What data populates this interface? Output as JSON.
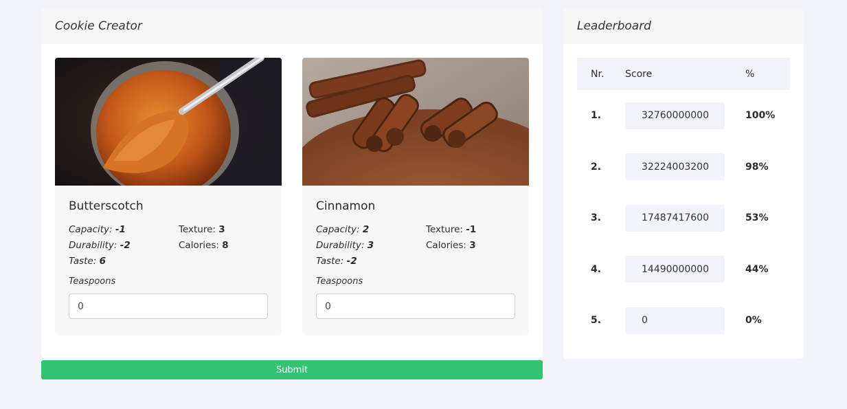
{
  "creator": {
    "title": "Cookie Creator",
    "ingredients": [
      {
        "name": "Butterscotch",
        "image_icon": "butterscotch-photo",
        "capacity_label": "Capacity:",
        "capacity": "-1",
        "durability_label": "Durability:",
        "durability": "-2",
        "taste_label": "Taste:",
        "taste": "6",
        "texture_label": "Texture:",
        "texture": "3",
        "calories_label": "Calories:",
        "calories": "8",
        "teaspoons_label": "Teaspoons",
        "teaspoons_value": "0"
      },
      {
        "name": "Cinnamon",
        "image_icon": "cinnamon-photo",
        "capacity_label": "Capacity:",
        "capacity": "2",
        "durability_label": "Durability:",
        "durability": "3",
        "taste_label": "Taste:",
        "taste": "-2",
        "texture_label": "Texture:",
        "texture": "-1",
        "calories_label": "Calories:",
        "calories": "3",
        "teaspoons_label": "Teaspoons",
        "teaspoons_value": "0"
      }
    ],
    "submit_label": "Submit"
  },
  "leaderboard": {
    "title": "Leaderboard",
    "headers": {
      "nr": "Nr.",
      "score": "Score",
      "pct": "%"
    },
    "rows": [
      {
        "nr": "1.",
        "score": "32760000000",
        "pct": "100%"
      },
      {
        "nr": "2.",
        "score": "32224003200",
        "pct": "98%"
      },
      {
        "nr": "3.",
        "score": "17487417600",
        "pct": "53%"
      },
      {
        "nr": "4.",
        "score": "14490000000",
        "pct": "44%"
      },
      {
        "nr": "5.",
        "score": "0",
        "pct": "0%"
      }
    ]
  },
  "colors": {
    "accent": "#36c273",
    "background": "#f3f4f9",
    "card": "#f7f7f7"
  }
}
